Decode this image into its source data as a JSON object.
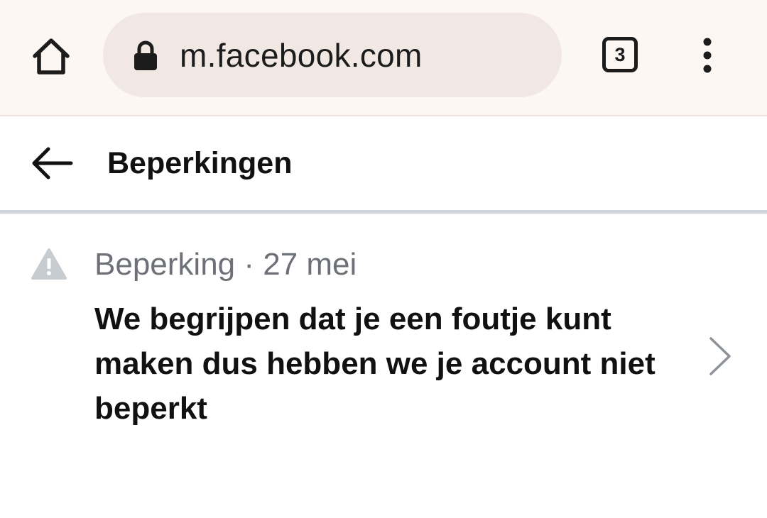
{
  "browser": {
    "url": "m.facebook.com",
    "tab_count": "3",
    "icons": {
      "home": "home-icon",
      "lock": "lock-icon",
      "tabs": "tab-switcher-icon",
      "menu": "more-vert-icon"
    }
  },
  "header": {
    "title": "Beperkingen",
    "back_icon": "arrow-left-icon"
  },
  "restriction": {
    "meta": "Beperking · 27 mei",
    "message": "We begrijpen dat je een foutje kunt maken dus hebben we je account niet beperkt",
    "icons": {
      "status": "warning-icon",
      "open": "chevron-right-icon"
    }
  },
  "colors": {
    "chrome_background": "#fdf7f4",
    "urlbar_background": "#f1e8e3",
    "divider": "#cfd4da",
    "meta_text": "#6d7177",
    "warning_icon": "#c7ccd1"
  }
}
